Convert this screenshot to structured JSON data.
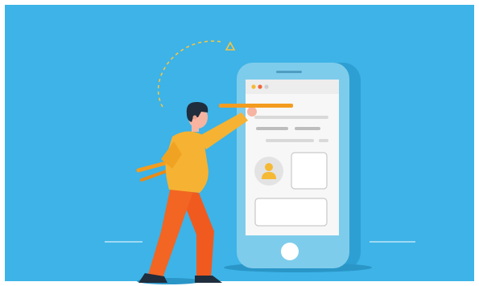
{
  "illustration": {
    "background_color": "#3DB3E7",
    "phone": {
      "body_color": "#7ECCEB",
      "screen_color": "#F7F7F7",
      "home_button_color": "#FFFFFF",
      "window_dots": [
        "#F5B933",
        "#F0663B",
        "#CFCFCF"
      ],
      "avatar_icon": "user-icon"
    },
    "person": {
      "shirt_color": "#F6B233",
      "pants_color": "#F05A1F",
      "skin_color": "#F6B4A1",
      "hair_color": "#1F2D3D",
      "holding": "orange-bar"
    },
    "decorations": [
      "dashed-arc",
      "triangle-outline-icon",
      "ground-lines"
    ],
    "accent_color": "#F39C1F"
  }
}
